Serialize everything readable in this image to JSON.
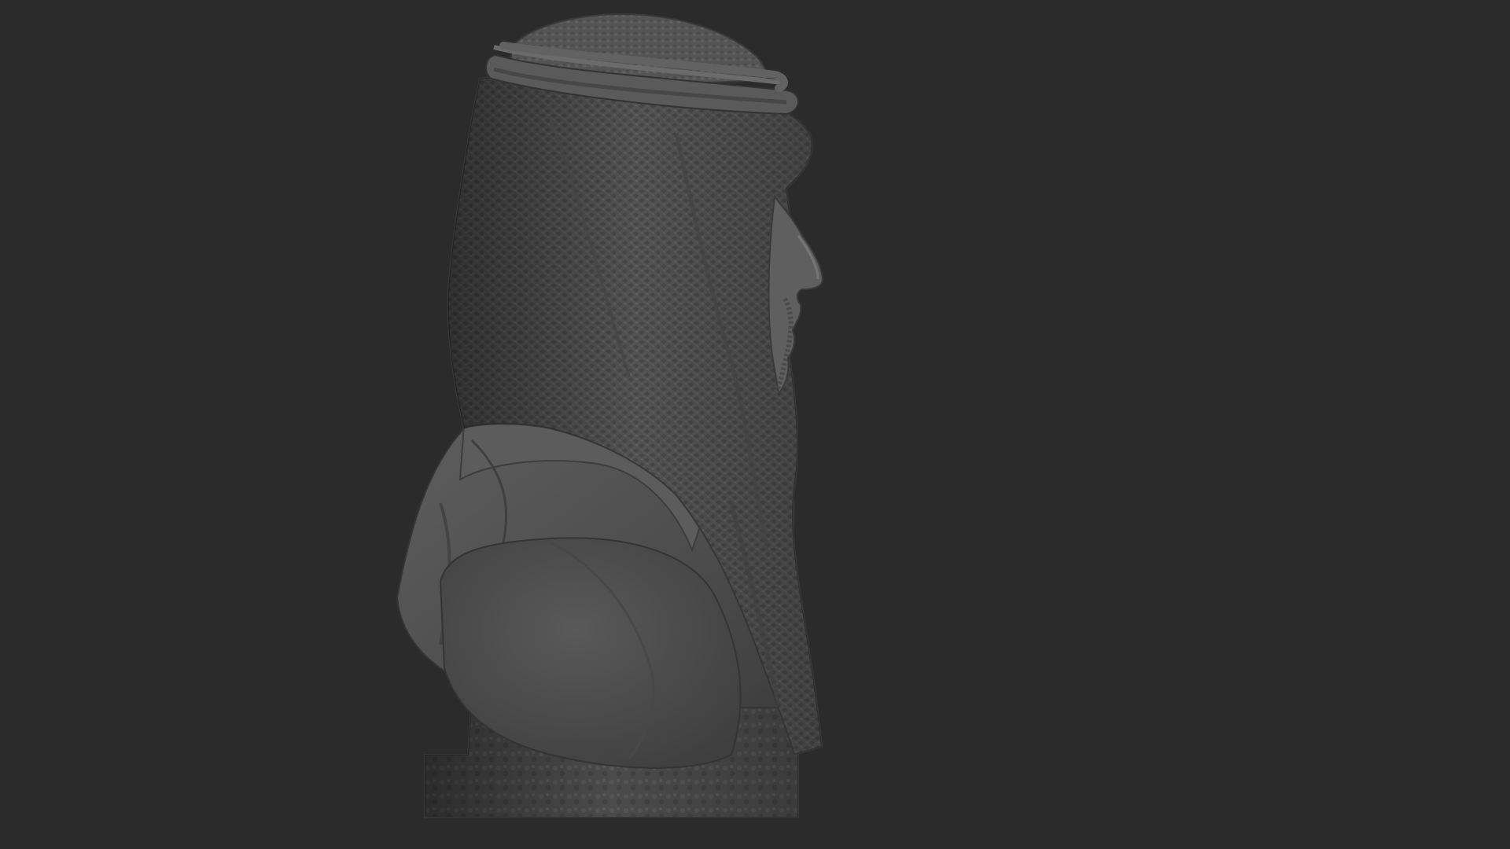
{
  "viewport": {
    "background_color": "#2b2b2b"
  },
  "model": {
    "subject": "sculpted-bust-profile",
    "base_color": "#5a5a5a",
    "shadow_color": "#3a3a3a",
    "highlight_color": "#787878"
  }
}
